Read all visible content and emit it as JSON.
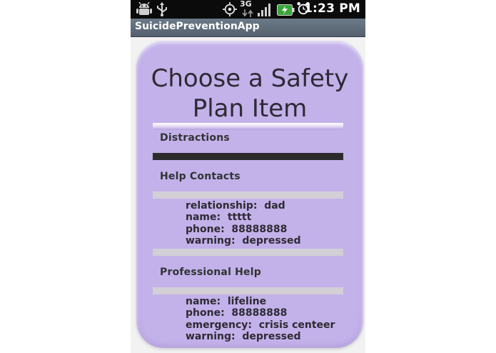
{
  "status_bar": {
    "time": "1:23 PM",
    "network": "3G",
    "icons": [
      "android-debug-icon",
      "usb-icon",
      "gps-icon",
      "network-3g-icon",
      "signal-icon",
      "battery-charging-icon",
      "alarm-clock-icon"
    ]
  },
  "app": {
    "title": "SuicidePreventionApp"
  },
  "card": {
    "title": "Choose a Safety Plan Item",
    "sections": {
      "distractions": {
        "label": "Distractions"
      },
      "help_contacts": {
        "label": "Help Contacts",
        "rows": [
          {
            "key": "relationship:",
            "value": "dad"
          },
          {
            "key": "name:",
            "value": "ttttt"
          },
          {
            "key": "phone:",
            "value": "88888888"
          },
          {
            "key": "warning:",
            "value": "depressed"
          }
        ]
      },
      "professional_help": {
        "label": "Professional Help",
        "rows": [
          {
            "key": "name:",
            "value": "lifeline"
          },
          {
            "key": "phone:",
            "value": "88888888"
          },
          {
            "key": "emergency:",
            "value": "crisis centeer"
          },
          {
            "key": "warning:",
            "value": "depressed"
          }
        ]
      }
    }
  },
  "colors": {
    "card_background": "#c3b1ea",
    "title_bar": "#5f6b7a",
    "status_bar": "#0b0b0b",
    "separator_light": "#d2cfd6",
    "separator_dark": "#2b2b2b",
    "battery_green": "#3aa53a"
  }
}
